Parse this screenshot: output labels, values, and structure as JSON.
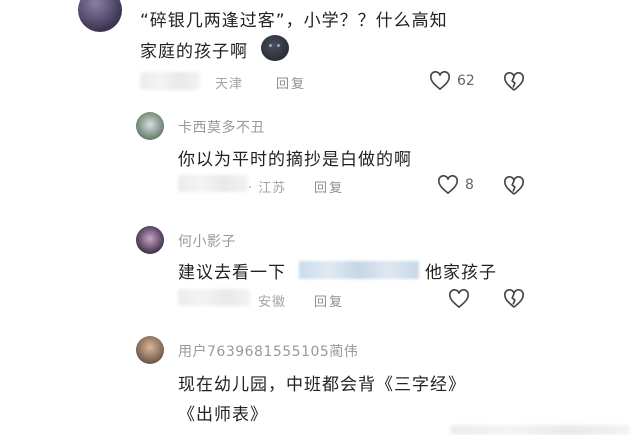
{
  "c1": {
    "line1": "“碎银几两逢过客”，小学？？什么高知",
    "line2": "家庭的孩子啊",
    "location": "天津",
    "reply": "回复",
    "likes": "62"
  },
  "r1": {
    "username": "卡西莫多不丑",
    "text": "你以为平时的摘抄是白做的啊",
    "location": "· 江苏",
    "reply": "回复",
    "likes": "8"
  },
  "r2": {
    "username": "何小影子",
    "text_prefix": "建议去看一下",
    "text_suffix": "他家孩子",
    "location": "安徽",
    "reply": "回复"
  },
  "r3": {
    "username": "用户7639681555105蔺伟",
    "line1": "现在幼儿园，中班都会背《三字经》",
    "line2": "《出师表》"
  },
  "icons": [
    "heart-icon",
    "broken-heart-icon",
    "dark-face-emoji"
  ]
}
